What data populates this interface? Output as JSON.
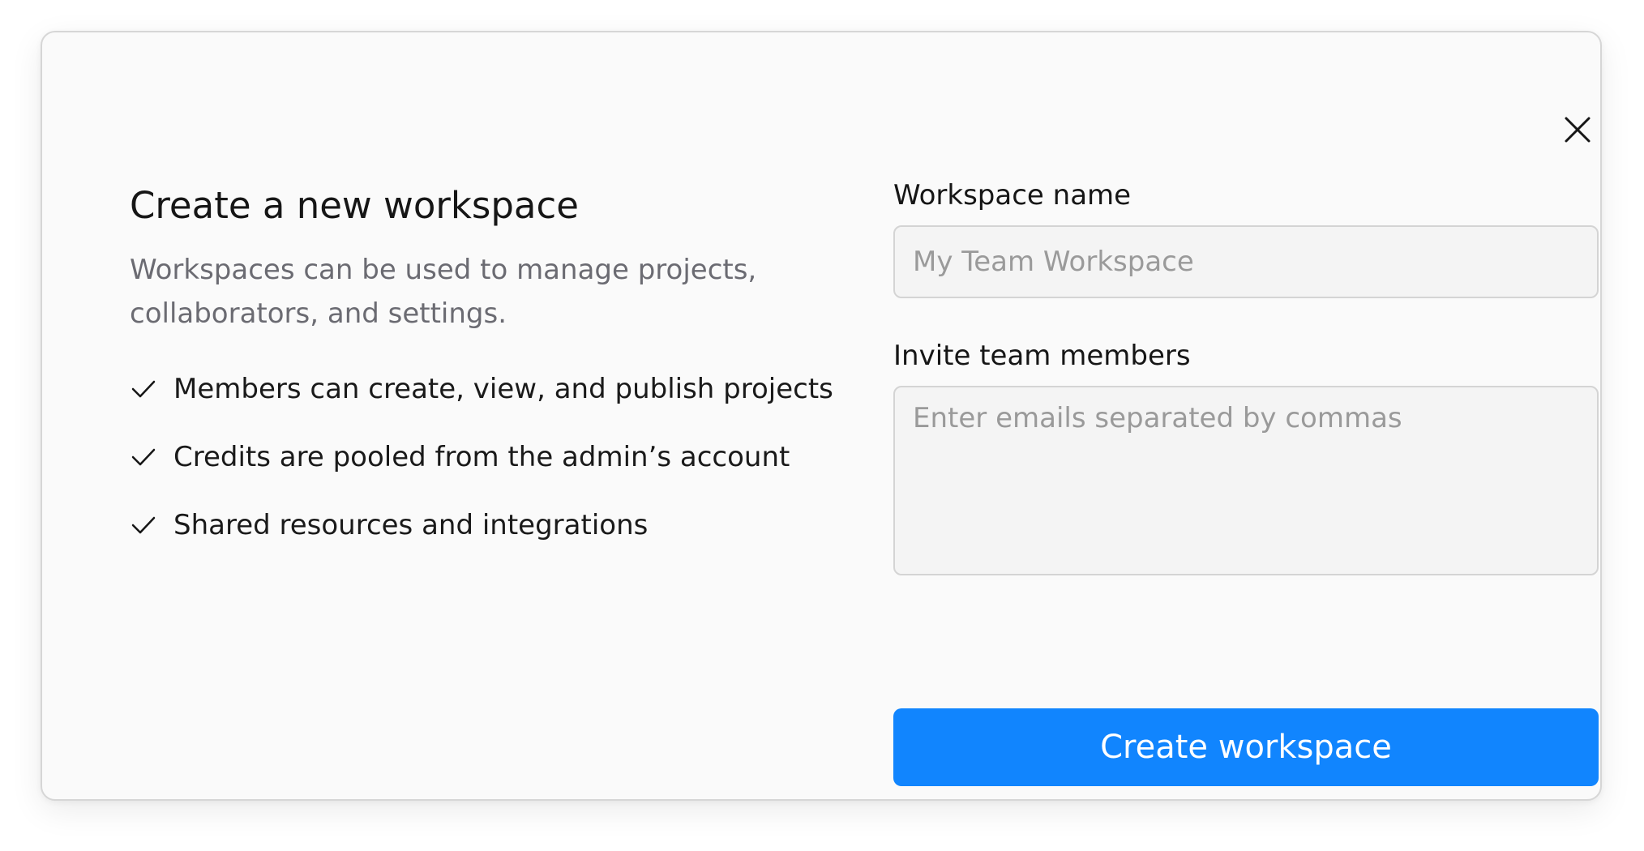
{
  "dialog": {
    "title": "Create a new workspace",
    "description": "Workspaces can be used to manage projects, collaborators, and settings.",
    "close_icon": "close-icon",
    "features": [
      {
        "icon": "checkmark-icon",
        "label": "Members can create, view, and publish projects"
      },
      {
        "icon": "checkmark-icon",
        "label": "Credits are pooled from the admin’s account"
      },
      {
        "icon": "checkmark-icon",
        "label": "Shared resources and integrations"
      }
    ]
  },
  "form": {
    "workspace_name": {
      "label": "Workspace name",
      "value": "",
      "placeholder": "My Team Workspace"
    },
    "invite_members": {
      "label": "Invite team members",
      "value": "",
      "placeholder": "Enter emails separated by commas"
    },
    "submit_label": "Create workspace"
  },
  "colors": {
    "accent": "#1185fe",
    "dialog_background": "#fafafa",
    "input_background": "#f4f4f4",
    "muted_text": "#6b6b72"
  }
}
